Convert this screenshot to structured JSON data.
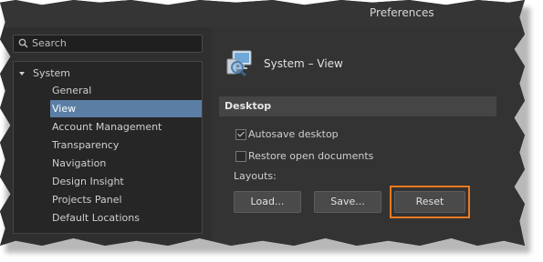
{
  "window": {
    "title": "Preferences"
  },
  "search": {
    "placeholder": "Search"
  },
  "tree": {
    "root": "System",
    "items": [
      {
        "label": "General"
      },
      {
        "label": "View",
        "selected": true
      },
      {
        "label": "Account Management"
      },
      {
        "label": "Transparency"
      },
      {
        "label": "Navigation"
      },
      {
        "label": "Design Insight"
      },
      {
        "label": "Projects Panel"
      },
      {
        "label": "Default Locations"
      }
    ]
  },
  "page": {
    "title": "System – View",
    "icon": "monitor-magnifier-icon"
  },
  "desktop": {
    "header": "Desktop",
    "autosave": {
      "label": "Autosave desktop",
      "checked": true
    },
    "restore": {
      "label": "Restore open documents",
      "checked": false
    },
    "layouts_label": "Layouts:",
    "buttons": {
      "load": "Load...",
      "save": "Save...",
      "reset": "Reset"
    }
  },
  "colors": {
    "selection": "#5b7ea5",
    "highlight": "#ee7a1f"
  }
}
